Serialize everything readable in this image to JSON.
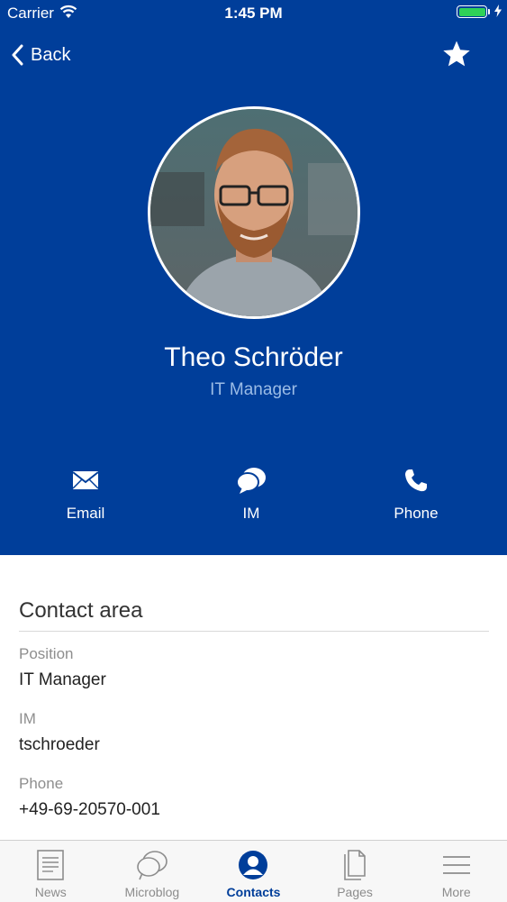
{
  "status_bar": {
    "carrier": "Carrier",
    "time": "1:45 PM"
  },
  "nav": {
    "back_label": "Back"
  },
  "profile": {
    "name": "Theo Schröder",
    "role": "IT Manager"
  },
  "actions": [
    {
      "label": "Email",
      "icon": "envelope-icon"
    },
    {
      "label": "IM",
      "icon": "chat-bubbles-icon"
    },
    {
      "label": "Phone",
      "icon": "phone-icon"
    }
  ],
  "contact": {
    "title": "Contact area",
    "fields": [
      {
        "label": "Position",
        "value": "IT Manager"
      },
      {
        "label": "IM",
        "value": "tschroeder"
      },
      {
        "label": "Phone",
        "value": "+49-69-20570-001"
      }
    ]
  },
  "tabs": [
    {
      "label": "News",
      "icon": "news-icon"
    },
    {
      "label": "Microblog",
      "icon": "microblog-icon"
    },
    {
      "label": "Contacts",
      "icon": "contacts-icon",
      "active": true
    },
    {
      "label": "Pages",
      "icon": "pages-icon"
    },
    {
      "label": "More",
      "icon": "menu-icon"
    }
  ],
  "colors": {
    "header_bg": "#003e9a",
    "active_tab": "#003e9a",
    "battery": "#2fd158"
  }
}
